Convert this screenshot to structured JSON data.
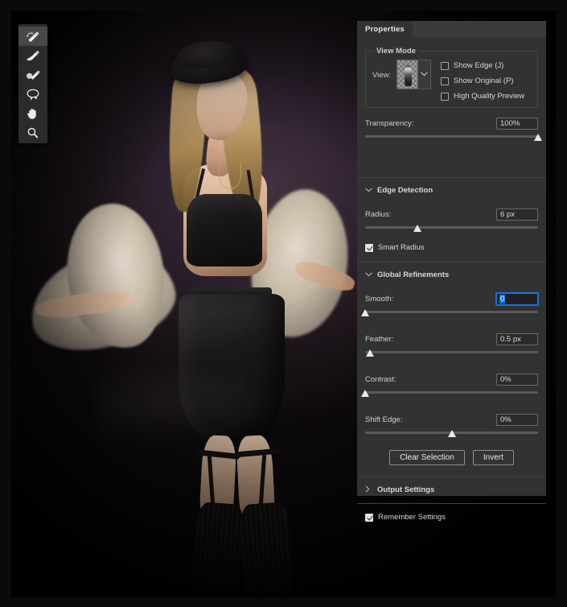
{
  "app": {
    "canvas_label": "refine-edge-workspace"
  },
  "toolbar": {
    "tools": [
      {
        "name": "quick-selection-tool",
        "label": "Quick Selection Tool",
        "active": true
      },
      {
        "name": "refine-edge-brush-tool",
        "label": "Refine Edge Brush Tool",
        "active": false
      },
      {
        "name": "brush-tool",
        "label": "Brush Tool",
        "active": false
      },
      {
        "name": "lasso-tool",
        "label": "Lasso Tool",
        "active": false
      },
      {
        "name": "hand-tool",
        "label": "Hand Tool",
        "active": false
      },
      {
        "name": "zoom-tool",
        "label": "Zoom Tool",
        "active": false
      }
    ]
  },
  "panel": {
    "tab_label": "Properties",
    "view_mode": {
      "group_title": "View Mode",
      "view_label": "View:",
      "thumbnail_icon": "checkerboard-preview-thumbnail",
      "dropdown_icon": "chevron-down-icon",
      "checkboxes": [
        {
          "label": "Show Edge (J)",
          "checked": false
        },
        {
          "label": "Show Original (P)",
          "checked": false
        },
        {
          "label": "High Quality Preview",
          "checked": false
        }
      ]
    },
    "transparency": {
      "label": "Transparency:",
      "value": "100%",
      "slider_pct": 100
    },
    "edge_detection": {
      "title": "Edge Detection",
      "expanded": true,
      "arrow_icon": "chevron-down-icon",
      "radius": {
        "label": "Radius:",
        "value": "6 px",
        "slider_pct": 30
      },
      "smart_radius": {
        "label": "Smart Radius",
        "checked": true
      }
    },
    "global_refinements": {
      "title": "Global Refinements",
      "expanded": true,
      "arrow_icon": "chevron-down-icon",
      "smooth": {
        "label": "Smooth:",
        "value": "0",
        "slider_pct": 0,
        "focused": true
      },
      "feather": {
        "label": "Feather:",
        "value": "0.5 px",
        "slider_pct": 3
      },
      "contrast": {
        "label": "Contrast:",
        "value": "0%",
        "slider_pct": 0
      },
      "shift_edge": {
        "label": "Shift Edge:",
        "value": "0%",
        "slider_pct": 50
      }
    },
    "buttons": {
      "clear_selection": "Clear Selection",
      "invert": "Invert"
    },
    "output_settings": {
      "title": "Output Settings",
      "expanded": false,
      "arrow_icon": "chevron-right-icon"
    },
    "remember_settings": {
      "label": "Remember Settings",
      "checked": true
    }
  },
  "colors": {
    "panel_bg": "#323232",
    "tabbar_bg": "#3b3b3b",
    "accent_focus": "#1473e6",
    "slider_thumb": "#e9e9e9",
    "text": "#d4d4d4"
  }
}
